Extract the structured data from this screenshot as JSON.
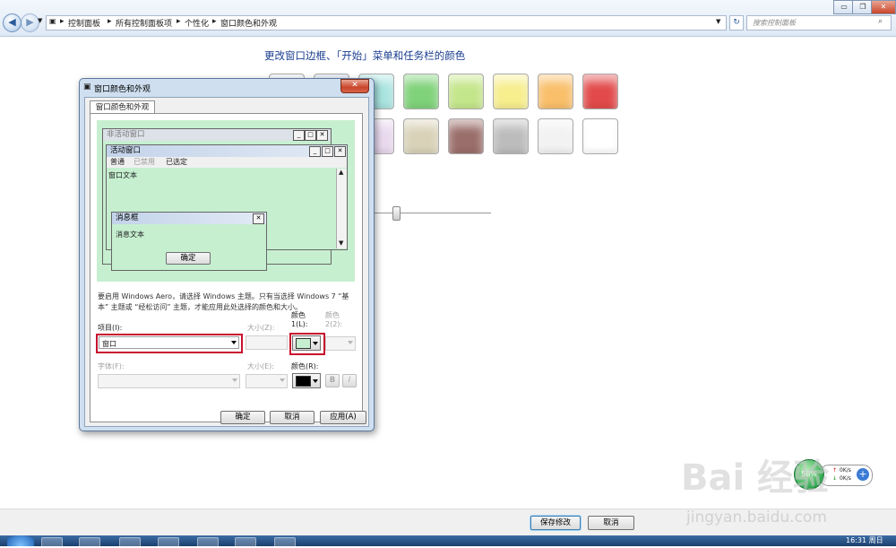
{
  "explorer": {
    "breadcrumbs": [
      "控制面板",
      "所有控制面板项",
      "个性化",
      "窗口颜色和外观"
    ],
    "search_placeholder": "搜索控制面板"
  },
  "main": {
    "heading": "更改窗口边框、「开始」菜单和任务栏的颜色",
    "swatch_colors_row1": [
      "#e6eef5",
      "#c9d7e6",
      "#a9e4e0",
      "#7fd27a",
      "#c4e68a",
      "#f7ee8e",
      "#f9bf6a",
      "#e24a4a"
    ],
    "swatch_colors_row2": [
      "#d0b3e3",
      "#b98fdc",
      "#e9d8ee",
      "#d9d2b8",
      "#9a6e6a",
      "#bcbcbc",
      "#f2f2f2",
      "#ffffff"
    ]
  },
  "dialog": {
    "title": "窗口颜色和外观",
    "tab": "窗口颜色和外观",
    "preview": {
      "inactive_title": "非活动窗口",
      "active_title": "活动窗口",
      "menu_items": [
        "普通",
        "已禁用",
        "已选定"
      ],
      "window_text": "窗口文本",
      "msgbox_title": "消息框",
      "msgbox_text": "消息文本",
      "msgbox_ok": "确定"
    },
    "explain": "要启用 Windows Aero，请选择 Windows 主题。只有当选择 Windows 7 “基本” 主题或 “经松访问” 主题，才能应用此处选择的颜色和大小。",
    "labels": {
      "item": "项目(I):",
      "size": "大小(Z):",
      "color1": "颜色 1(L):",
      "color2": "颜色 2(2):",
      "font": "字体(F):",
      "fontsize": "大小(E):",
      "fontcolor": "颜色(R):"
    },
    "item_value": "窗口",
    "color1_value": "#c6efd0",
    "fontcolor_value": "#000000",
    "bold": "B",
    "italic": "I",
    "buttons": {
      "ok": "确定",
      "cancel": "取消",
      "apply": "应用(A)"
    }
  },
  "bottom": {
    "save": "保存修改",
    "cancel": "取消"
  },
  "net_widget": {
    "percent": "58%",
    "up": "0K/s",
    "down": "0K/s"
  },
  "clock": "16:31 周日",
  "watermark": {
    "brand": "Bai 经验",
    "url": "jingyan.baidu.com"
  }
}
